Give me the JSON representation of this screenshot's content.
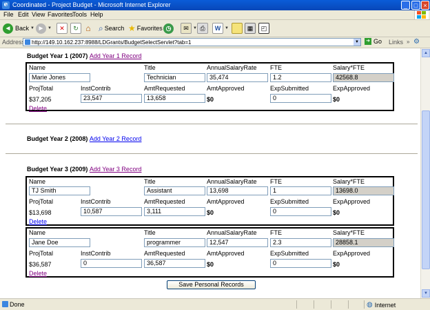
{
  "window": {
    "title": "Coordinated - Project Budget - Microsoft Internet Explorer"
  },
  "menu": [
    "File",
    "Edit",
    "View",
    "Favorites",
    "Tools",
    "Help"
  ],
  "toolbar": {
    "back": "Back",
    "search": "Search",
    "favorites": "Favorites"
  },
  "address": {
    "label": "Address",
    "url": "http://149.10.162.237:8988/LDGrants/BudgetSelectServlet?tab=1",
    "go": "Go",
    "links": "Links"
  },
  "labels": {
    "name": "Name",
    "title": "Title",
    "annual": "AnnualSalaryRate",
    "fte": "FTE",
    "salfte": "Salary*FTE",
    "projtotal": "ProjTotal",
    "inst": "InstContrib",
    "amtreq": "AmtRequested",
    "amtapp": "AmtApproved",
    "expsub": "ExpSubmitted",
    "expapp": "ExpApproved",
    "delete": "Delete"
  },
  "years": [
    {
      "heading": "Budget Year 1 (2007)",
      "link": "Add Year 1 Record"
    },
    {
      "heading": "Budget Year 2 (2008)",
      "link": "Add Year 2 Record"
    },
    {
      "heading": "Budget Year 3 (2009)",
      "link": "Add Year 3 Record"
    }
  ],
  "records": [
    {
      "name": "Marie Jones",
      "title": "Technician",
      "annual": "35,474",
      "fte": "1.2",
      "salfte": "42568.8",
      "projtotal": "$37,205",
      "inst": "23,547",
      "amtreq": "13,658",
      "amtapp": "$0",
      "expsub": "0",
      "expapp": "$0"
    },
    {
      "name": "TJ Smith",
      "title": "Assistant",
      "annual": "13,698",
      "fte": "1",
      "salfte": "13698.0",
      "projtotal": "$13,698",
      "inst": "10,587",
      "amtreq": "3,111",
      "amtapp": "$0",
      "expsub": "0",
      "expapp": "$0"
    },
    {
      "name": "Jane Doe",
      "title": "programmer",
      "annual": "12,547",
      "fte": "2.3",
      "salfte": "28858.1",
      "projtotal": "$36,587",
      "inst": "0",
      "amtreq": "36,587",
      "amtapp": "$0",
      "expsub": "0",
      "expapp": "$0"
    }
  ],
  "save_button": "Save Personal Records",
  "status": {
    "text": "Done",
    "zone": "Internet"
  }
}
